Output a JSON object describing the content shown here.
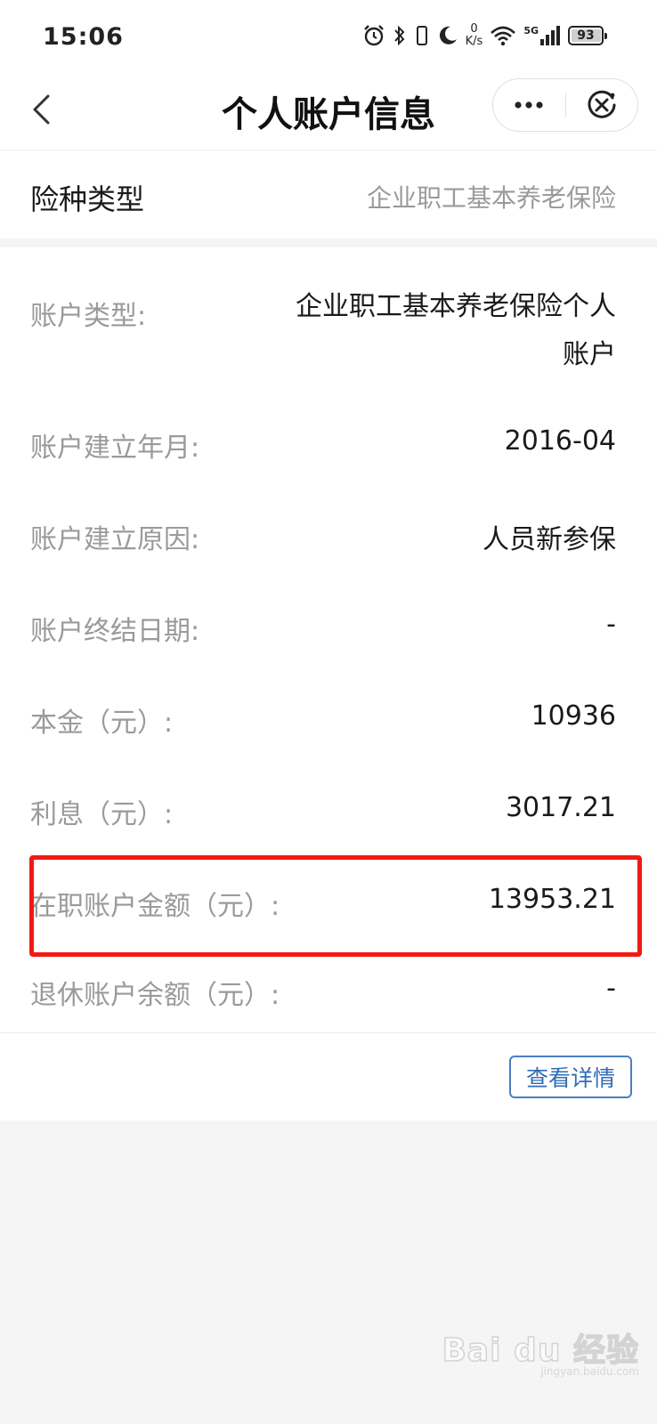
{
  "status_bar": {
    "time": "15:06",
    "net_speed_value": "0",
    "net_speed_unit": "K/s",
    "network_type": "5G",
    "battery_level": "93"
  },
  "nav": {
    "title": "个人账户信息"
  },
  "insurance": {
    "label": "险种类型",
    "value": "企业职工基本养老保险"
  },
  "details": [
    {
      "label": "账户类型:",
      "value": "企业职工基本养老保险个人账户"
    },
    {
      "label": "账户建立年月:",
      "value": "2016-04"
    },
    {
      "label": "账户建立原因:",
      "value": "人员新参保"
    },
    {
      "label": "账户终结日期:",
      "value": "-"
    },
    {
      "label": "本金（元）:",
      "value": "10936"
    },
    {
      "label": "利息（元）:",
      "value": "3017.21"
    },
    {
      "label": "在职账户金额（元）:",
      "value": "13953.21"
    },
    {
      "label": "退休账户余额（元）:",
      "value": "-"
    }
  ],
  "footer": {
    "detail_button_label": "查看详情"
  },
  "watermark": {
    "logo_text": "Bai du 经验",
    "site_text": "jingyan.baidu.com"
  },
  "colors": {
    "highlight_border": "#f21a10",
    "link_blue": "#2f6db5",
    "label_gray": "#9a9a9a"
  }
}
